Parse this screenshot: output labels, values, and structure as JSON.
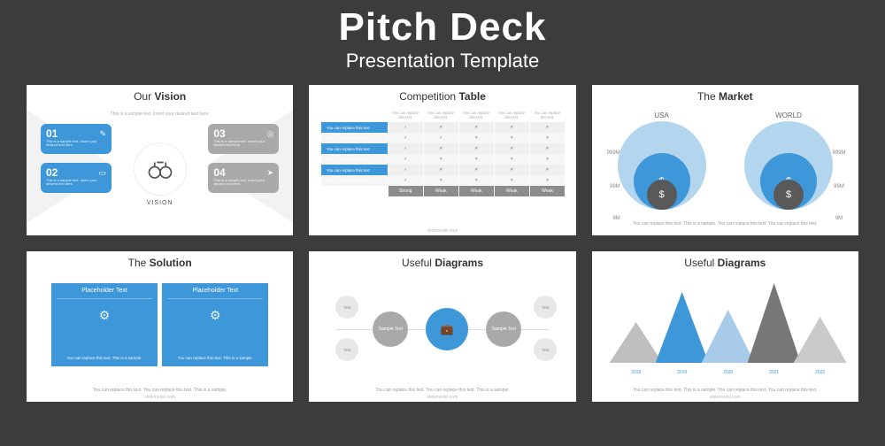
{
  "hero": {
    "title": "Pitch Deck",
    "subtitle": "Presentation Template"
  },
  "footer": "slidemodel.com",
  "caption3": "You can replace this text. This is a sample. You can replace this text. You can replace this text.",
  "caption2": "You can replace this text. You can replace this text.\nThis is a sample.",
  "s1": {
    "title_pre": "Our ",
    "title_b": "Vision",
    "sub": "This is a sample text. Insert\nyour desired text here.",
    "vision": "VISION",
    "cards": [
      {
        "num": "01",
        "txt": "This is a sample text. Insert your desired text here."
      },
      {
        "num": "02",
        "txt": "This is a sample text. Insert your desired text here."
      },
      {
        "num": "03",
        "txt": "This is a sample text. Insert your desired text here."
      },
      {
        "num": "04",
        "txt": "This is a sample text. Insert your desired text here."
      }
    ]
  },
  "s2": {
    "title_pre": "Competition ",
    "title_b": "Table",
    "colhead": "You can replace this text.",
    "rowhead": "You can replace this text",
    "check": "✓",
    "cross": "✕",
    "footer": [
      "Strong",
      "Weak",
      "Weak",
      "Weak",
      "Weak"
    ]
  },
  "s3": {
    "title_pre": "The ",
    "title_b": "Market",
    "cols": [
      "USA",
      "WORLD"
    ],
    "labels": [
      "999M",
      "99M",
      "9M"
    ],
    "dollar": "$"
  },
  "s4": {
    "title_pre": "The ",
    "title_b": "Solution",
    "ph": "Placeholder Text",
    "bt": "You can replace this text.\nThis is a sample."
  },
  "s5": {
    "title_pre": "Useful ",
    "title_b": "Diagrams",
    "text": "Text",
    "sample": "Sample Text"
  },
  "s6": {
    "title_pre": "Useful ",
    "title_b": "Diagrams"
  },
  "chart_data": {
    "type": "bar",
    "title": "Useful Diagrams",
    "categories": [
      "2018",
      "2019",
      "2020",
      "2021",
      "2022"
    ],
    "values": [
      46,
      80,
      60,
      90,
      52
    ],
    "colors": [
      "#BFBFBF",
      "#3D97D8",
      "#A7CBE8",
      "#777777",
      "#C9C9C9"
    ],
    "xlabel": "",
    "ylabel": "",
    "ylim": [
      0,
      100
    ]
  }
}
